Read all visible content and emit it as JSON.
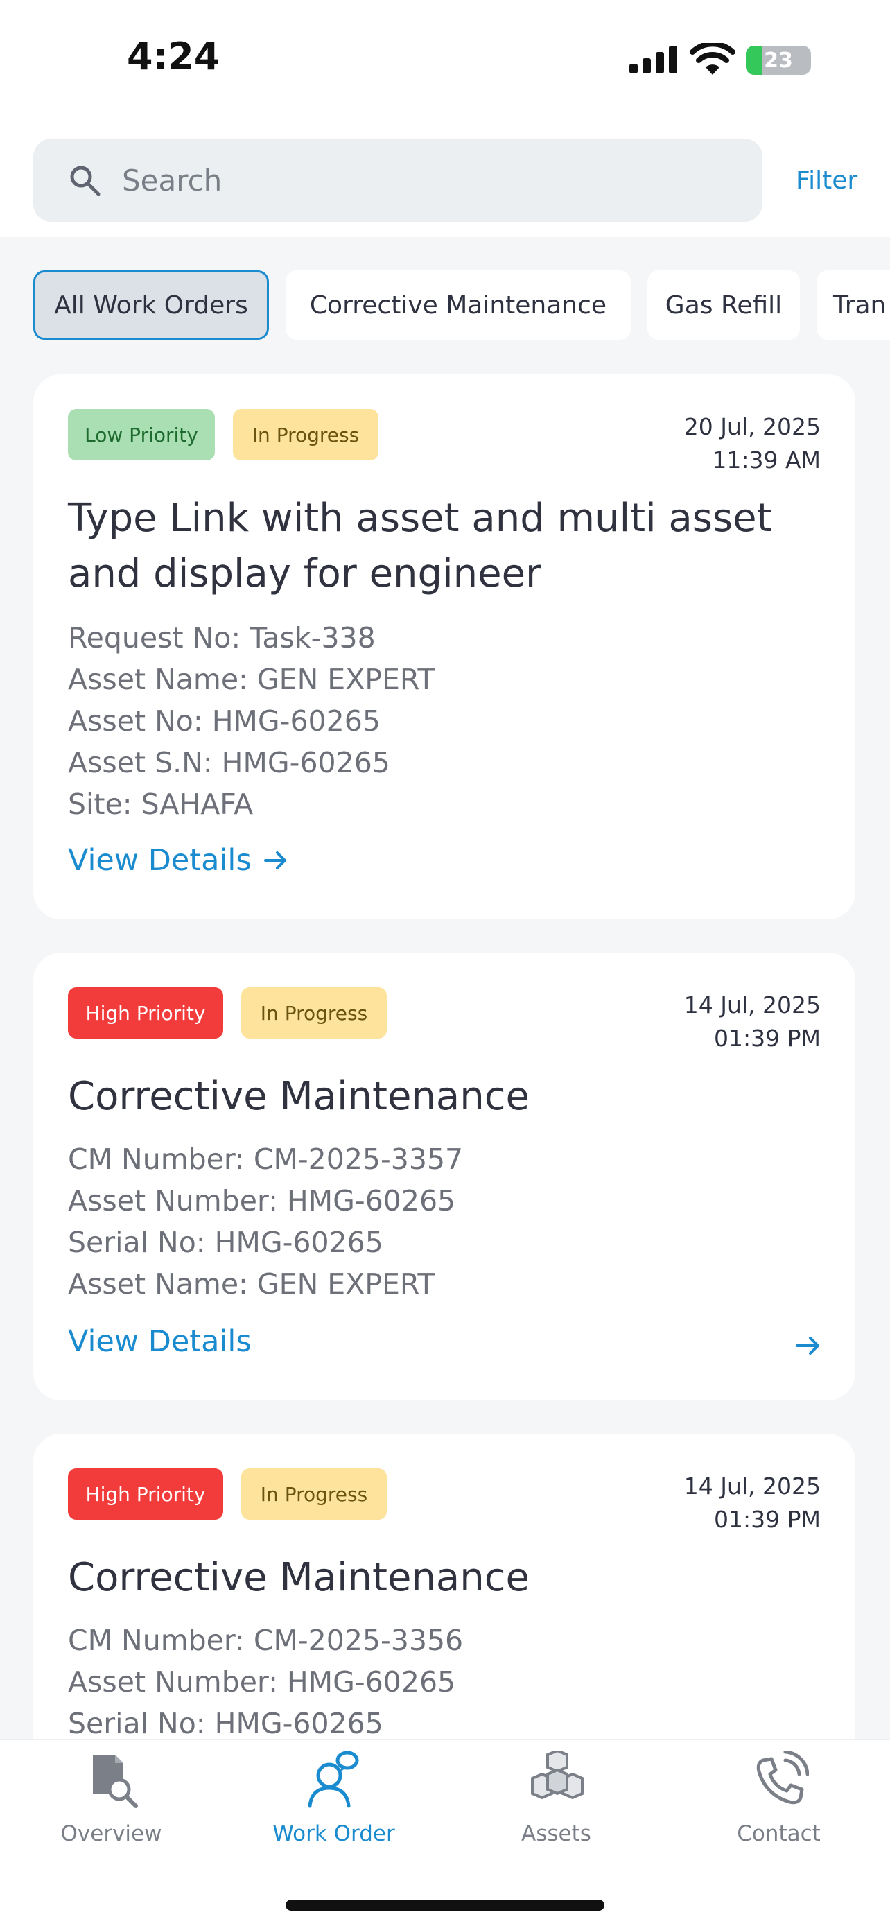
{
  "status_bar": {
    "time": "4:24",
    "battery": "23"
  },
  "search": {
    "placeholder": "Search",
    "filter_label": "Filter"
  },
  "filters": [
    "All Work Orders",
    "Corrective Maintenance",
    "Gas Refill",
    "Tran"
  ],
  "cards": [
    {
      "priority": "Low Priority",
      "status": "In Progress",
      "date": "20 Jul, 2025",
      "time": "11:39 AM",
      "title": "Type Link with asset and multi asset and display for engineer",
      "fields": [
        "Request No:  Task-338",
        "Asset Name:  GEN EXPERT",
        "Asset No:  HMG-60265",
        "Asset S.N:  HMG-60265",
        "Site:  SAHAFA"
      ],
      "link": "View Details"
    },
    {
      "priority": "High Priority",
      "status": "In Progress",
      "date": "14 Jul, 2025",
      "time": "01:39 PM",
      "title": "Corrective Maintenance",
      "fields": [
        "CM Number: CM-2025-3357",
        "Asset Number:  HMG-60265",
        "Serial No:  HMG-60265",
        "Asset Name: GEN EXPERT"
      ],
      "link": "View Details"
    },
    {
      "priority": "High Priority",
      "status": "In Progress",
      "date": "14 Jul, 2025",
      "time": "01:39 PM",
      "title": "Corrective Maintenance",
      "fields": [
        "CM Number: CM-2025-3356",
        "Asset Number:  HMG-60265",
        "Serial No:  HMG-60265"
      ]
    }
  ],
  "nav": [
    {
      "label": "Overview",
      "icon": "document-search-icon"
    },
    {
      "label": "Work Order",
      "icon": "user-chat-icon"
    },
    {
      "label": "Assets",
      "icon": "boxes-icon"
    },
    {
      "label": "Contact",
      "icon": "phone-icon"
    }
  ],
  "colors": {
    "accent": "#1b8bcf",
    "high_priority": "#f23b3b",
    "low_priority": "#a9dfb2",
    "in_progress": "#fde39c"
  }
}
